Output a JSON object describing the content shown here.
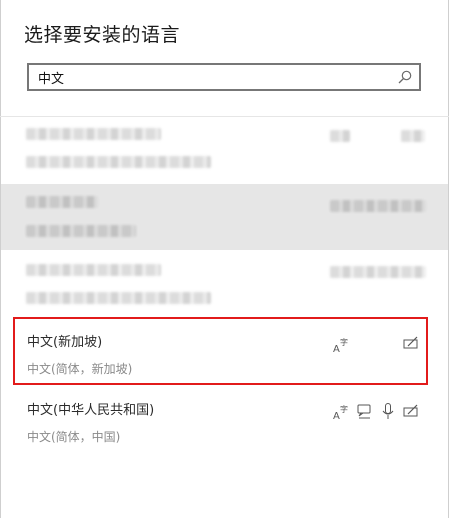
{
  "dialog": {
    "title": "选择要安装的语言"
  },
  "search": {
    "value": "中文",
    "placeholder": ""
  },
  "languages": [
    {
      "name": "中文(新加坡)",
      "sub": "中文(简体，新加坡)",
      "features": [
        "text-to-speech-icon",
        "handwriting-icon"
      ]
    },
    {
      "name": "中文(中华人民共和国)",
      "sub": "中文(简体，中国)",
      "features": [
        "text-to-speech-icon",
        "speech-icon",
        "microphone-icon",
        "handwriting-icon"
      ]
    }
  ],
  "colors": {
    "selection_outline": "#e21b1b",
    "hover_row": "#e6e6e6",
    "secondary_text": "#8a8a8a"
  }
}
